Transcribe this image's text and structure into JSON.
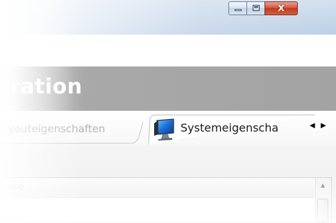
{
  "window": {
    "min_button": "minimize",
    "max_button": "maximize",
    "close_label": "X"
  },
  "header": {
    "title_fragment": "ration"
  },
  "tabs": {
    "inactive_label": "youteigenschaften",
    "active_label": "Systemeigenscha",
    "scroll_left": "◀",
    "scroll_right": "▶"
  },
  "list": {
    "column_header_fragment": "sse",
    "scroll_up": "▲"
  },
  "colors": {
    "heading_band": "#a3a3a3",
    "close_button": "#c0391f",
    "titlebar": "#c9d8ea"
  },
  "icons": {
    "active_tab_icon": "monitor-icon"
  }
}
